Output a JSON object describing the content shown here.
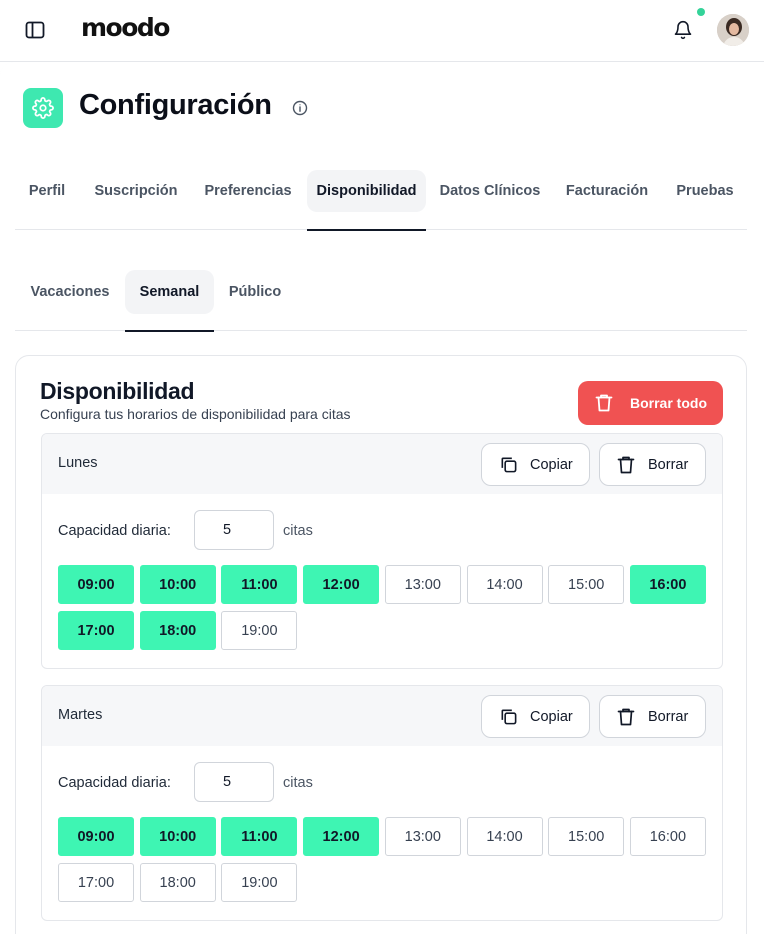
{
  "app": {
    "logo": "moodo",
    "accent_color": "#3ef5b3",
    "danger_color": "#f05252",
    "notification_dot_color": "#34d399"
  },
  "header": {
    "title": "Configuración"
  },
  "tabs": [
    {
      "label": "Perfil",
      "active": false
    },
    {
      "label": "Suscripción",
      "active": false
    },
    {
      "label": "Preferencias",
      "active": false
    },
    {
      "label": "Disponibilidad",
      "active": true
    },
    {
      "label": "Datos Clínicos",
      "active": false
    },
    {
      "label": "Facturación",
      "active": false
    },
    {
      "label": "Pruebas",
      "active": false
    }
  ],
  "subtabs": [
    {
      "label": "Vacaciones",
      "active": false
    },
    {
      "label": "Semanal",
      "active": true
    },
    {
      "label": "Público",
      "active": false
    }
  ],
  "card": {
    "title": "Disponibilidad",
    "subtitle": "Configura tus horarios de disponibilidad para citas",
    "clear_all_label": "Borrar todo"
  },
  "days": [
    {
      "name": "Lunes",
      "copy_label": "Copiar",
      "delete_label": "Borrar",
      "capacity_label": "Capacidad diaria:",
      "capacity_value": "5",
      "capacity_unit": "citas",
      "slots": [
        {
          "time": "09:00",
          "selected": true
        },
        {
          "time": "10:00",
          "selected": true
        },
        {
          "time": "11:00",
          "selected": true
        },
        {
          "time": "12:00",
          "selected": true
        },
        {
          "time": "13:00",
          "selected": false
        },
        {
          "time": "14:00",
          "selected": false
        },
        {
          "time": "15:00",
          "selected": false
        },
        {
          "time": "16:00",
          "selected": true
        },
        {
          "time": "17:00",
          "selected": true
        },
        {
          "time": "18:00",
          "selected": true
        },
        {
          "time": "19:00",
          "selected": false
        }
      ]
    },
    {
      "name": "Martes",
      "copy_label": "Copiar",
      "delete_label": "Borrar",
      "capacity_label": "Capacidad diaria:",
      "capacity_value": "5",
      "capacity_unit": "citas",
      "slots": [
        {
          "time": "09:00",
          "selected": true
        },
        {
          "time": "10:00",
          "selected": true
        },
        {
          "time": "11:00",
          "selected": true
        },
        {
          "time": "12:00",
          "selected": true
        },
        {
          "time": "13:00",
          "selected": false
        },
        {
          "time": "14:00",
          "selected": false
        },
        {
          "time": "15:00",
          "selected": false
        },
        {
          "time": "16:00",
          "selected": false
        },
        {
          "time": "17:00",
          "selected": false
        },
        {
          "time": "18:00",
          "selected": false
        },
        {
          "time": "19:00",
          "selected": false
        }
      ]
    }
  ]
}
